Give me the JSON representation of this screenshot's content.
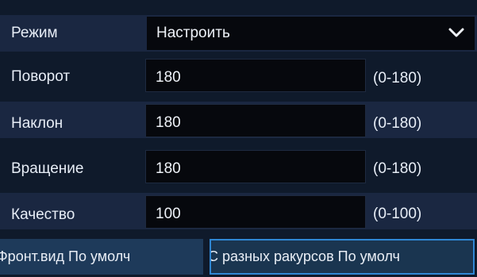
{
  "mode": {
    "label": "Режим",
    "value": "Настроить",
    "icon": "chevron-down-icon"
  },
  "fields": [
    {
      "label": "Поворот",
      "value": "180",
      "range": "(0-180)"
    },
    {
      "label": "Наклон",
      "value": "180",
      "range": "(0-180)"
    },
    {
      "label": "Вращение",
      "value": "180",
      "range": "(0-180)"
    },
    {
      "label": "Качество",
      "value": "100",
      "range": "(0-100)"
    }
  ],
  "buttons": {
    "front_view": "Фронт.вид По умолч",
    "multi_angle": "С разных ракурсов По умолч"
  },
  "colors": {
    "background": "#0f1a2b",
    "row_alt": "#1a2741",
    "field_bg": "#06080d",
    "button_bg": "#1e3a5a",
    "button_focus_border": "#2f87d4"
  }
}
